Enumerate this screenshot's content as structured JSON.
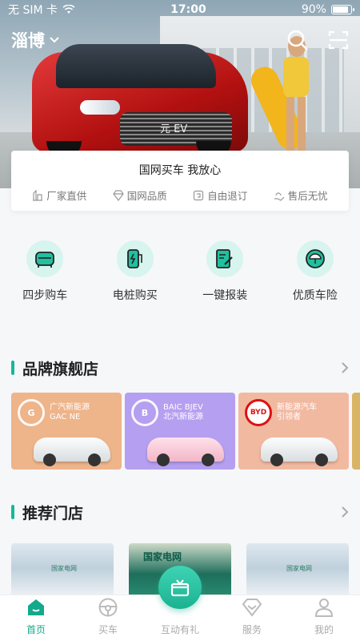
{
  "status_bar": {
    "carrier": "无 SIM 卡",
    "time": "17:00",
    "battery": "90%",
    "battery_level": 0.9
  },
  "header": {
    "city": "淄博"
  },
  "promise": {
    "title": "国网买车  我放心",
    "features": [
      "厂家直供",
      "国网品质",
      "自由退订",
      "售后无忧"
    ]
  },
  "services": [
    {
      "label": "四步购车",
      "icon": "car-front-icon"
    },
    {
      "label": "电桩购买",
      "icon": "charging-pile-icon"
    },
    {
      "label": "一键报装",
      "icon": "edit-form-icon"
    },
    {
      "label": "优质车险",
      "icon": "umbrella-icon"
    }
  ],
  "brand_section": {
    "title": "品牌旗舰店"
  },
  "brands": [
    {
      "logo_text": "G",
      "name_cn": "广汽新能源",
      "name_en": "GAC NE"
    },
    {
      "logo_text": "B",
      "name_cn": "北汽新能源",
      "name_en": "BAIC BJEV"
    },
    {
      "logo_text": "BYD",
      "name_cn": "新能源汽车",
      "name_en": "引领者"
    }
  ],
  "store_section": {
    "title": "推荐门店"
  },
  "stores": [
    {
      "sign": "国家电网"
    },
    {
      "sign": "国家电网"
    },
    {
      "sign": "国家电网"
    }
  ],
  "tabs": [
    {
      "label": "首页"
    },
    {
      "label": "买车"
    },
    {
      "label": "互动有礼"
    },
    {
      "label": "服务"
    },
    {
      "label": "我的"
    }
  ],
  "colors": {
    "accent": "#17b89c",
    "tab_active": "#13a98b",
    "icon_bg": "#d7f4ee"
  }
}
